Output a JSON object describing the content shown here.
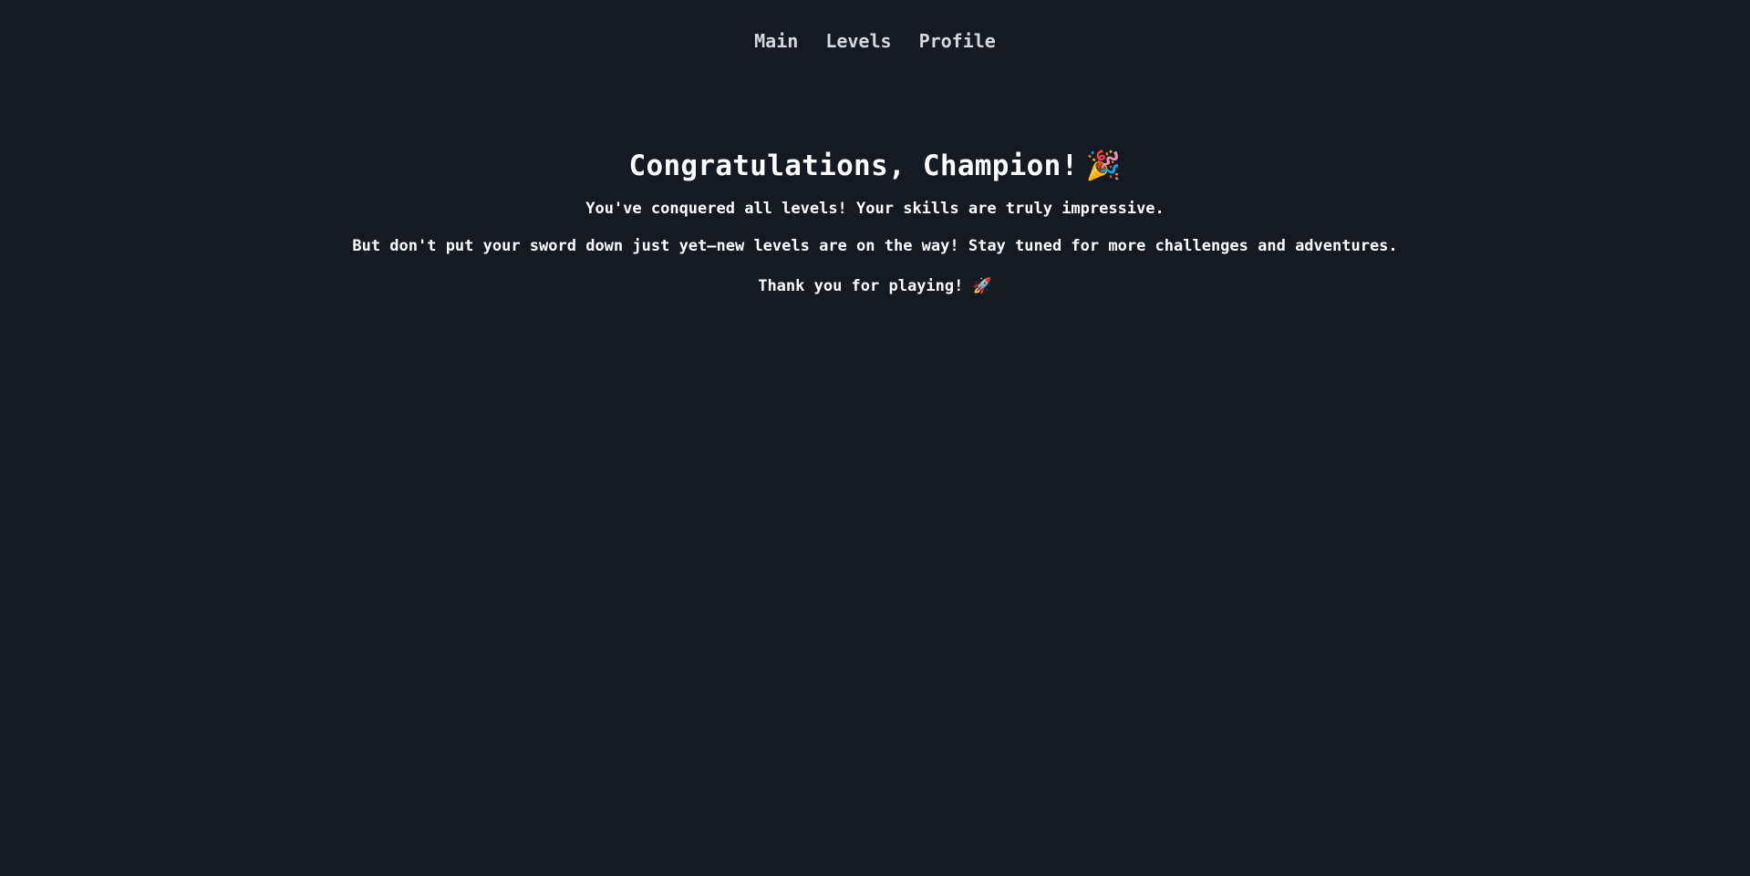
{
  "nav": {
    "items": [
      {
        "label": "Main"
      },
      {
        "label": "Levels"
      },
      {
        "label": "Profile"
      }
    ]
  },
  "main": {
    "title": "Congratulations, Champion!",
    "title_emoji": "🎉",
    "subtitle": "You've conquered all levels! Your skills are truly impressive.",
    "message": "But don't put your sword down just yet—new levels are on the way! Stay tuned for more challenges and adventures.",
    "thanks": "Thank you for playing!",
    "thanks_emoji": "🚀"
  },
  "colors": {
    "background": "#141a22",
    "text": "#ffffff",
    "nav_text": "#d5d8dc"
  }
}
